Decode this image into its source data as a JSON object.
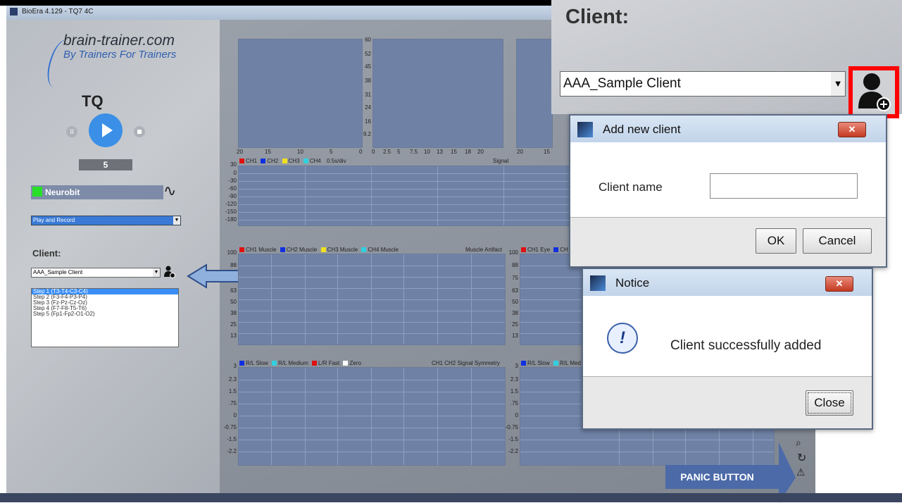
{
  "window": {
    "title": "BioEra 4.129 - TQ7 4C"
  },
  "logo": {
    "line1": "brain-trainer.com",
    "line2": "By Trainers For Trainers"
  },
  "protocol": {
    "name": "TQ",
    "counter": "5"
  },
  "transport": {
    "pause": "II"
  },
  "device": {
    "name": "Neurobit",
    "status_color": "#28e028",
    "wave_glyph": "∿"
  },
  "mode": {
    "selected": "Play and Record"
  },
  "client": {
    "label": "Client:",
    "selected": "AAA_Sample Client",
    "steps": [
      "Step 1 (T3-T4-C3-C4)",
      "Step 2 (F3-F4-P3-P4)",
      "Step 3 (Fz-Pz-Cz-Oz)",
      "Step 4 (F7-F8-T5-T6)",
      "Step 5 (Fp1-Fp2-O1-O2)"
    ],
    "selected_step": 0
  },
  "charts": {
    "top_bar_ticks": [
      "60",
      "52",
      "45",
      "38",
      "31",
      "24",
      "16",
      "9.2"
    ],
    "top_xaxis_left": [
      "20",
      "15",
      "10",
      "5",
      "0"
    ],
    "top_xaxis_mid": [
      "0",
      "2.5",
      "5",
      "7.5",
      "10",
      "13",
      "15",
      "18",
      "20"
    ],
    "top_xaxis_right": [
      "20",
      "15"
    ],
    "signal_legend": [
      "CH1",
      "CH2",
      "CH3",
      "CH4",
      "0.5s/div"
    ],
    "signal_title": "Signal",
    "signal_ticks": [
      "30",
      "0",
      "-30",
      "-60",
      "-90",
      "-120",
      "-150",
      "-180"
    ],
    "muscle_legend": [
      "CH1 Muscle",
      "CH2 Muscle",
      "CH3 Muscle",
      "CH4 Muscle"
    ],
    "muscle_title": "Muscle Artifact",
    "muscle_ticks": [
      "100",
      "88",
      "75",
      "63",
      "50",
      "38",
      "25",
      "13"
    ],
    "eye_legend": [
      "CH1 Eye",
      "CH"
    ],
    "eye_ticks": [
      "100",
      "88",
      "75",
      "63",
      "50",
      "38",
      "25",
      "13"
    ],
    "sym_legend": [
      "R/L Slow",
      "R/L Medium",
      "L/R Fast",
      "Zero"
    ],
    "sym_title": "CH1 CH2 Signal Symmetry",
    "sym_ticks": [
      "3",
      "2.3",
      "1.5",
      ".75",
      "0",
      "-0.75",
      "-1.5",
      "-2.2"
    ],
    "sym2_legend": [
      "R/L Slow",
      "R/L Med"
    ],
    "sym2_ticks": [
      "3",
      "2.3",
      "1.5",
      ".75",
      "0",
      "-0.75",
      "-1.5",
      "-2.2"
    ],
    "colors": {
      "red": "#e01010",
      "blue": "#1030e0",
      "yellow": "#f0e020",
      "cyan": "#30d0e0",
      "white": "#ffffff"
    }
  },
  "zoom_panel": {
    "label": "Client:",
    "selected": "AAA_Sample Client",
    "highlight_color": "#ff0000"
  },
  "add_client_dialog": {
    "title": "Add new client",
    "close_glyph": "✕",
    "field_label": "Client name",
    "field_value": "",
    "ok": "OK",
    "cancel": "Cancel"
  },
  "notice_dialog": {
    "title": "Notice",
    "close_glyph": "✕",
    "icon_glyph": "!",
    "message": "Client successfully added",
    "close": "Close"
  },
  "annotation": {
    "panic_label": "PANIC BUTTON"
  },
  "side_icons": [
    "magnifier-icon",
    "reset-icon",
    "warning-icon"
  ],
  "side_glyphs": {
    "reset": "↻",
    "warning": "⚠",
    "magnifier": "🔍"
  }
}
